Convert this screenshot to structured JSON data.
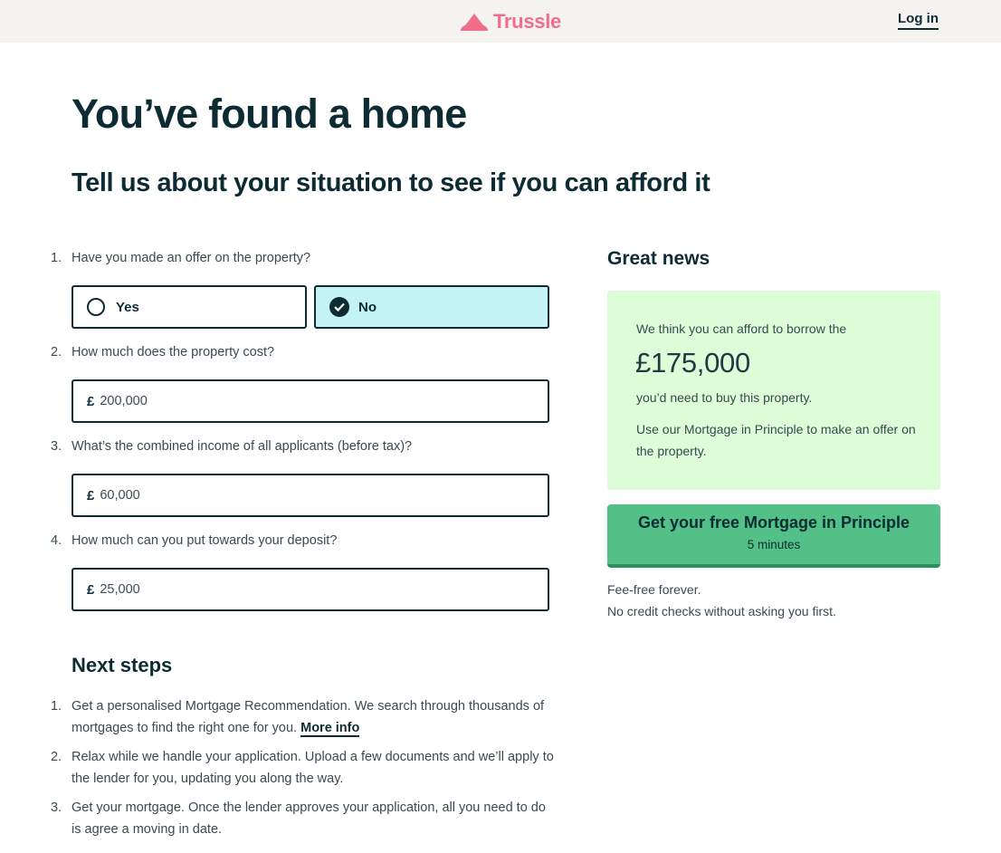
{
  "header": {
    "brand": "Trussle",
    "login_label": "Log in"
  },
  "page": {
    "title": "You’ve found a home",
    "subtitle": "Tell us about your situation to see if you can afford it"
  },
  "questions": [
    {
      "number": "1.",
      "label": "Have you made an offer on the property?"
    },
    {
      "number": "2.",
      "label": "How much does the property cost?"
    },
    {
      "number": "3.",
      "label": "What’s the combined income of all applicants (before tax)?"
    },
    {
      "number": "4.",
      "label": "How much can you put towards your deposit?"
    }
  ],
  "offer": {
    "options": [
      {
        "label": "Yes",
        "selected": false
      },
      {
        "label": "No",
        "selected": true
      }
    ]
  },
  "fields": {
    "currency": "£",
    "property_cost": "200,000",
    "income": "60,000",
    "deposit": "25,000"
  },
  "next_steps": {
    "title": "Next steps",
    "items": [
      {
        "number": "1.",
        "text": "Get a personalised Mortgage Recommendation. We search through thousands of mortgages to find the right one for you.",
        "link": "More info"
      },
      {
        "number": "2.",
        "text": "Relax while we handle your application. Upload a few documents and we’ll apply to the lender for you, updating you along the way."
      },
      {
        "number": "3.",
        "text": "Get your mortgage. Once the lender approves your application, all you need to do is agree a moving in date."
      }
    ]
  },
  "result": {
    "heading": "Great news",
    "intro": "We think you can afford to borrow the",
    "amount": "£175,000",
    "line2": "you’d need to buy this property.",
    "line3": "Use our Mortgage in Principle to make an offer on the property."
  },
  "cta": {
    "label": "Get your free Mortgage in Principle",
    "sublabel": "5 minutes"
  },
  "notes": [
    "Fee-free forever.",
    "No credit checks without asking you first."
  ],
  "colors": {
    "brand": "#f26d8a",
    "ink": "#0d2b33",
    "selected_bg": "#c3f3f5",
    "result_bg": "#dcfdd7",
    "cta_bg": "#52c087"
  }
}
